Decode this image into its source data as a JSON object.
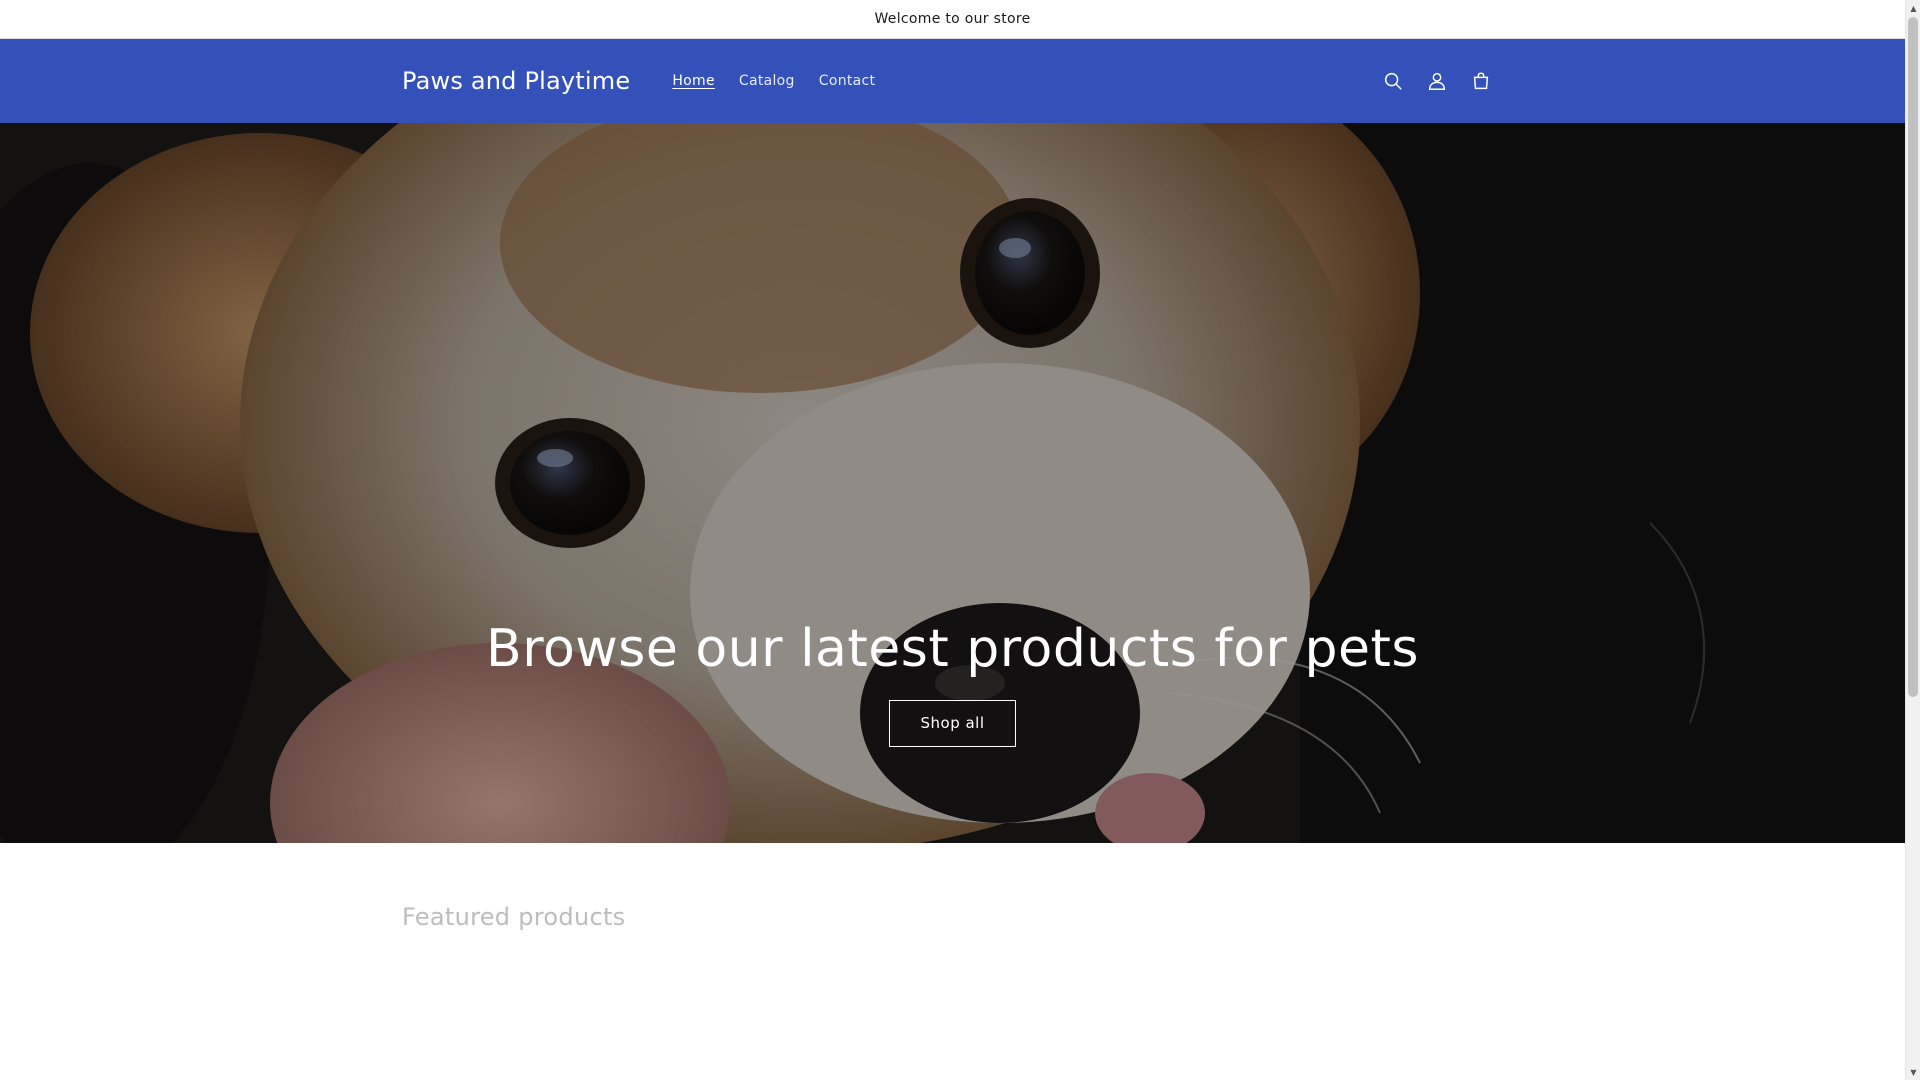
{
  "announcement": {
    "text": "Welcome to our store"
  },
  "header": {
    "logo": "Paws and Playtime",
    "nav": [
      {
        "label": "Home",
        "active": true
      },
      {
        "label": "Catalog",
        "active": false
      },
      {
        "label": "Contact",
        "active": false
      }
    ],
    "icons": [
      "search-icon",
      "account-icon",
      "cart-icon"
    ],
    "background_color": "#3351b8"
  },
  "hero": {
    "title": "Browse our latest products for pets",
    "button_label": "Shop all",
    "image_subject": "close-up of a small tan and white dog resting its head on a hand"
  },
  "featured": {
    "heading": "Featured products"
  },
  "scrollbar": {
    "up_icon": "chevron-up-icon",
    "down_icon": "chevron-down-icon"
  }
}
